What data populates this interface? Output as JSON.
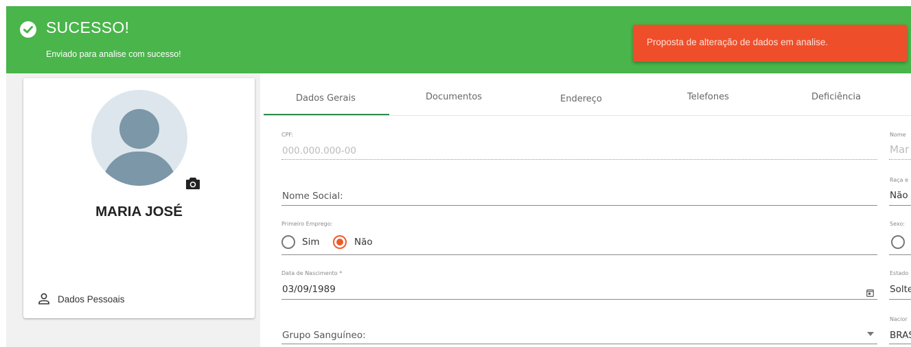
{
  "banner": {
    "title": "SUCESSO!",
    "subtitle": "Enviado para analise com sucesso!",
    "color": "#49b54a"
  },
  "toast": {
    "message": "Proposta de alteração de dados em analise.",
    "color": "#ef4e2a"
  },
  "profile": {
    "name": "MARIA JOSÉ",
    "menu_item": "Dados Pessoais"
  },
  "tabs": [
    {
      "label": "Dados Gerais",
      "active": true
    },
    {
      "label": "Documentos",
      "active": false
    },
    {
      "label": "Endereço",
      "active": false
    },
    {
      "label": "Telefones",
      "active": false
    },
    {
      "label": "Deficiência",
      "active": false
    }
  ],
  "form": {
    "cpf": {
      "label": "CPF:",
      "placeholder": "000.000.000-00"
    },
    "nome_social": {
      "label": "Nome Social:"
    },
    "primeiro_emprego": {
      "label": "Primeiro Emprego:",
      "options": [
        "Sim",
        "Não"
      ],
      "selected": "Não"
    },
    "data_nascimento": {
      "label": "Data de Nascimento *",
      "value": "03/09/1989"
    },
    "grupo_sanguineo": {
      "label": "Grupo Sanguíneo:"
    }
  },
  "right_column_clipped": {
    "nome": {
      "label": "Nome",
      "value": "Mar"
    },
    "raca": {
      "label": "Raça e",
      "value": "Não"
    },
    "sexo": {
      "label": "Sexo:"
    },
    "estado": {
      "label": "Estado",
      "value": "Solte"
    },
    "nacionalidade": {
      "label": "Nacior",
      "value": "BRAS"
    }
  },
  "accent_colors": {
    "success": "#49b54a",
    "error": "#ef4e2a",
    "tab_active": "#2e8b4b",
    "radio_selected": "#ef5a2b"
  }
}
